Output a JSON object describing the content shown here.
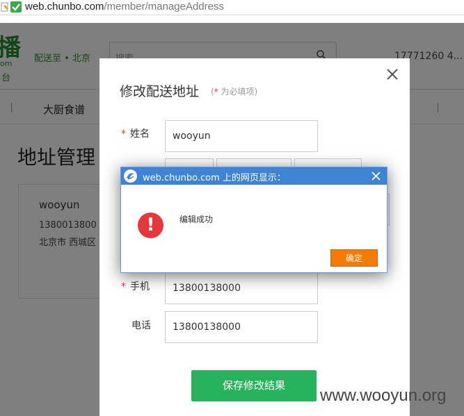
{
  "address_bar": {
    "url_domain": "web.chunbo.com",
    "url_path": "/member/manageAddress"
  },
  "background_page": {
    "logo_char": "播",
    "logo_com": "om",
    "logo_tai": "台",
    "deliver_to": "配送至 • 北京",
    "search_placeholder": "搜索",
    "phone": "17771260 4...",
    "nav_item": "大厨食谱",
    "page_title": "地址管理",
    "card": {
      "name": "wooyun",
      "phone": "1380013800",
      "address": "北京市 西城区"
    }
  },
  "edit_modal": {
    "title": "修改配送地址",
    "required_note_open": "(",
    "required_star": "*",
    "required_note": " 为必填项)",
    "name_label": "姓名",
    "name_value": "wooyun",
    "mobile_label": "手机",
    "mobile_value": "13800138000",
    "tel_label": "电话",
    "tel_value": "13800138000",
    "required_marker": "*",
    "save_button": "保存修改结果"
  },
  "alert": {
    "title": "web.chunbo.com 上的网页显示：",
    "message": "编辑成功",
    "ok_button": "确定",
    "icon_glyph": "!"
  },
  "watermark": "www.wooyun.org",
  "colors": {
    "brand_green": "#27b35c",
    "alert_titlebar": "#3f83d4",
    "alert_ok": "#f57c00",
    "error_icon": "#e5383c",
    "required_star": "#e33"
  }
}
